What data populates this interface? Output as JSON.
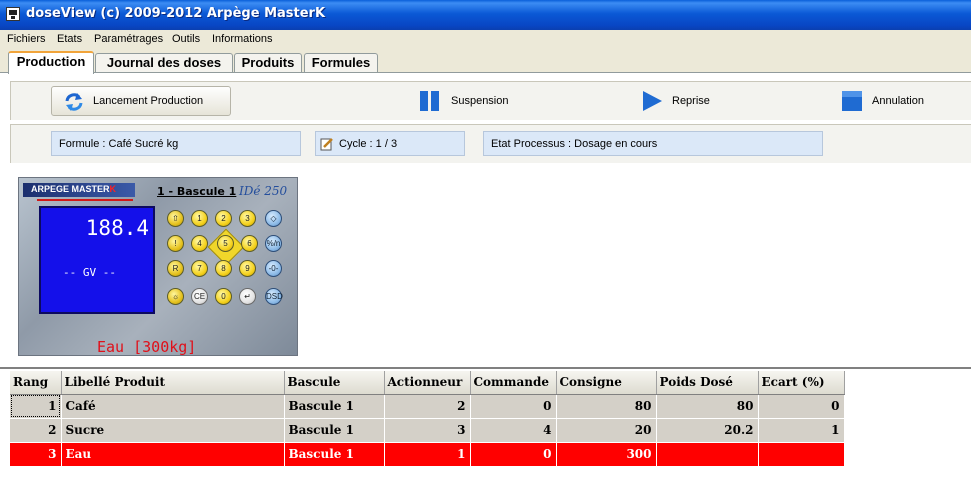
{
  "window": {
    "title": "doseView (c) 2009-2012 Arpège MasterK"
  },
  "menu": {
    "items": [
      "Fichiers",
      "Etats",
      "Paramétrages",
      "Outils",
      "Informations"
    ]
  },
  "tabs": [
    "Production",
    "Journal des doses",
    "Produits",
    "Formules"
  ],
  "toolbar": {
    "launch": "Lancement Production",
    "suspend": "Suspension",
    "resume": "Reprise",
    "cancel": "Annulation"
  },
  "info": {
    "formula": "Formule :  Café Sucré kg",
    "cycle": "Cycle : 1 / 3",
    "state": "Etat Processus :  Dosage en cours"
  },
  "device": {
    "brand": "ARPEGE MASTER",
    "brand_k": "K",
    "scale": "1 - Bascule 1",
    "model": "IDé 250",
    "weight": "188.4",
    "mode": "-- GV --",
    "product": "Eau [300kg]",
    "keys": {
      "r1": [
        "1",
        "2",
        "3"
      ],
      "r2": [
        "4",
        "5",
        "6"
      ],
      "r3": [
        "7",
        "8",
        "9"
      ],
      "r4": [
        "CE",
        "0"
      ],
      "side": [
        "%/n",
        "-0-",
        "DSD"
      ]
    }
  },
  "table": {
    "columns": [
      "Rang",
      "Libellé Produit",
      "Bascule",
      "Actionneur",
      "Commande",
      "Consigne",
      "Poids Dosé",
      "Ecart (%)"
    ],
    "rows": [
      {
        "rang": "1",
        "produit": "Café",
        "bascule": "Bascule 1",
        "actionneur": "2",
        "commande": "0",
        "consigne": "80",
        "poids": "80",
        "ecart": "0"
      },
      {
        "rang": "2",
        "produit": "Sucre",
        "bascule": "Bascule 1",
        "actionneur": "3",
        "commande": "4",
        "consigne": "20",
        "poids": "20.2",
        "ecart": "1"
      },
      {
        "rang": "3",
        "produit": "Eau",
        "bascule": "Bascule 1",
        "actionneur": "1",
        "commande": "0",
        "consigne": "300",
        "poids": "",
        "ecart": ""
      }
    ]
  },
  "colors": {
    "titlebar": "#0b59d6",
    "selected_row": "#ff0000",
    "lcd": "#1410ea",
    "accent_icon": "#1a6fd8"
  }
}
